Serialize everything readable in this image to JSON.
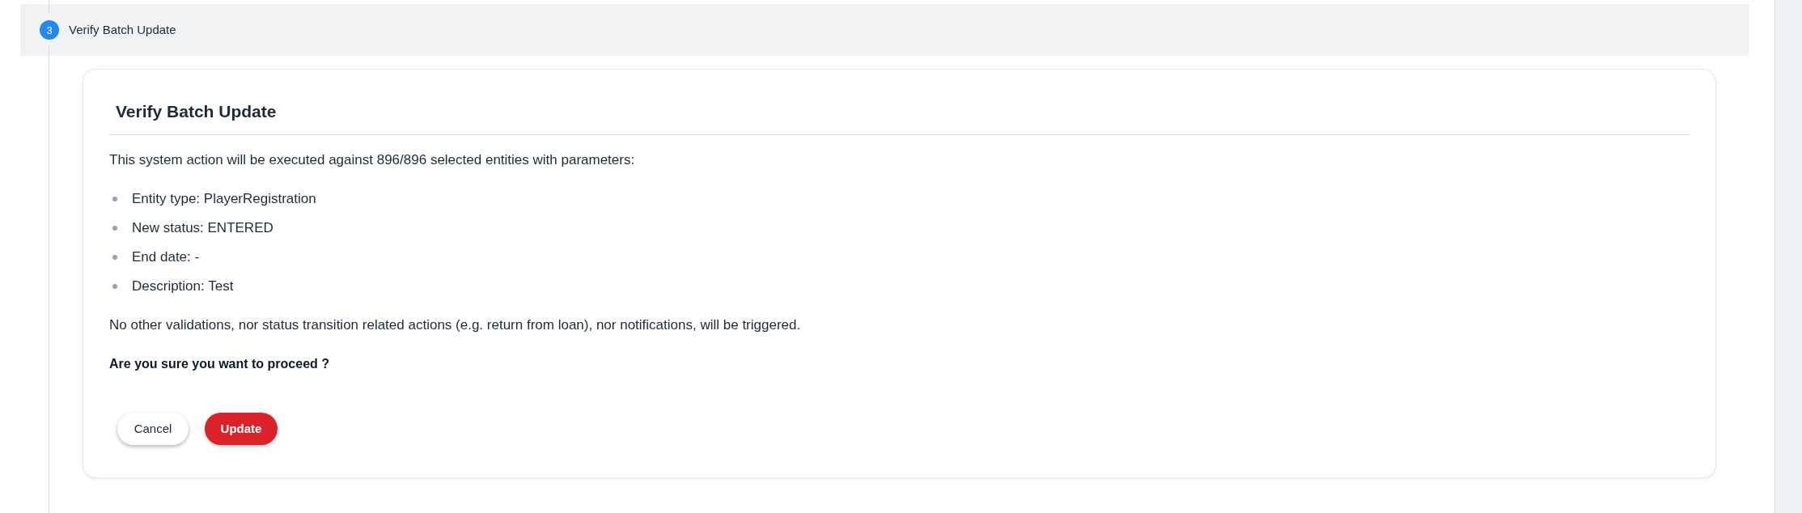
{
  "step": {
    "number": "3",
    "title": "Verify Batch Update"
  },
  "card": {
    "title": "Verify Batch Update",
    "intro": "This system action will be executed against 896/896 selected entities with parameters:",
    "parameters": [
      "Entity type: PlayerRegistration",
      "New status: ENTERED",
      "End date: -",
      "Description: Test"
    ],
    "note": "No other validations, nor status transition related actions (e.g. return from loan), nor notifications, will be triggered.",
    "question": "Are you sure you want to proceed ?",
    "buttons": [
      {
        "label": "Cancel",
        "kind": "secondary"
      },
      {
        "label": "Update",
        "kind": "primary"
      }
    ]
  }
}
